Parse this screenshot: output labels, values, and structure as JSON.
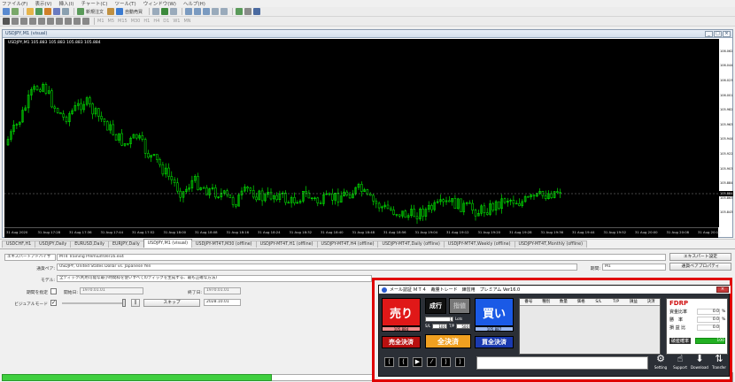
{
  "menu": [
    "ファイル(F)",
    "表示(V)",
    "挿入(I)",
    "チャート(C)",
    "ツール(T)",
    "ウィンドウ(W)",
    "ヘルプ(H)"
  ],
  "toolbar": {
    "new_order": "新規注文",
    "auto_trade": "自動売買"
  },
  "chart": {
    "window_title": "USDJPY,M1 (visual)",
    "symbol_label": "USDJPY,M1  105.883 105.883 105.883 105.884",
    "current_price": "105.884",
    "y_ticks": [
      "106.062",
      "106.044",
      "106.023",
      "106.001",
      "105.982",
      "105.963",
      "105.944",
      "105.922",
      "105.903",
      "105.884",
      "105.863",
      "105.843"
    ],
    "x_ticks": [
      "31 Aug 2020",
      "31 Aug 17:28",
      "31 Aug 17:36",
      "31 Aug 17:44",
      "31 Aug 17:52",
      "31 Aug 18:00",
      "31 Aug 18:08",
      "31 Aug 18:16",
      "31 Aug 18:24",
      "31 Aug 18:32",
      "31 Aug 18:40",
      "31 Aug 18:48",
      "31 Aug 18:56",
      "31 Aug 19:04",
      "31 Aug 19:12",
      "31 Aug 19:20",
      "31 Aug 19:28",
      "31 Aug 19:36",
      "31 Aug 19:44",
      "31 Aug 19:52",
      "31 Aug 20:00",
      "31 Aug 20:08",
      "31 Aug 20:16"
    ],
    "candle_color": "#00ff00"
  },
  "tabs": [
    "USDCHF,H1",
    "USDJPY,Daily",
    "EURUSD,Daily",
    "EURJPY,Daily",
    "USDJPY,M1 (visual)",
    "USDJPY-MT4T,M30 (offline)",
    "USDJPY-MT4T,H1 (offline)",
    "USDJPY-MT4T,H4 (offline)",
    "USDJPY-MT4T,Daily (offline)",
    "USDJPY-MT4T,Weekly (offline)",
    "USDJPY-MT4T,Monthly (offline)"
  ],
  "tester": {
    "ea_type": "エキスパートアドバイザ",
    "ea_name": "MT4 Training PremiumVer16.ex4",
    "ea_settings": "エキスパート設定",
    "symbol_label": "通貨ペア:",
    "symbol_value": "USDJPY, United States Dollar vs. Japanese Yen",
    "period_label": "期間:",
    "period_value": "M1",
    "symbol_props": "通貨ペアプロパティ",
    "model_label": "モデル:",
    "model_value": "全ティック(利用可能な最小時間枠を使いすべてのティックを生成する、最も正確な方法)",
    "use_date": "期間を指定",
    "from_label": "開始日:",
    "from_value": "1970.01.01",
    "to_label": "終了日:",
    "to_value": "1970.01.01",
    "visual_label": "ビジュアルモード",
    "skip": "スキップ",
    "skip_date": "2028.10.01",
    "stop": "ストップ"
  },
  "panel": {
    "title_items": [
      "メール認証 ＭＴ４",
      "裁量トレード",
      "練習用",
      "プレミアム Ver16.0"
    ],
    "sell": "売り",
    "buy": "買い",
    "market": "成行",
    "limit": "指値",
    "sell_price": "105.884",
    "buy_price": "105.887",
    "lots": "1",
    "lot_unit": "Lots",
    "sl_label": "S/L",
    "sl_value": "100",
    "tp_label": "T/P",
    "tp_value": "500",
    "close_sell": "売全決済",
    "close_all": "全決済",
    "close_buy": "買全決済",
    "order_headers": [
      "番号",
      "種別",
      "数量",
      "価格",
      "S/L",
      "T/P",
      "損益",
      "決済"
    ],
    "fdrp": {
      "title": "FDRP",
      "rows": [
        {
          "label": "資金比率",
          "value": "0.0",
          "unit": "%"
        },
        {
          "label": "勝　率",
          "value": "0.0",
          "unit": "%"
        },
        {
          "label": "損 益 比",
          "value": "0.0",
          "unit": ""
        }
      ],
      "margin_label": "破産確率",
      "margin_value": "100"
    },
    "nav": [
      "⟨",
      "⟨",
      "▶",
      "⁄",
      "⟩",
      "⟩"
    ],
    "icons": [
      {
        "label": "Setting",
        "glyph": "⚙"
      },
      {
        "label": "Support",
        "glyph": "☝"
      },
      {
        "label": "Download",
        "glyph": "⬇"
      },
      {
        "label": "Transfer",
        "glyph": "⇅"
      }
    ]
  }
}
